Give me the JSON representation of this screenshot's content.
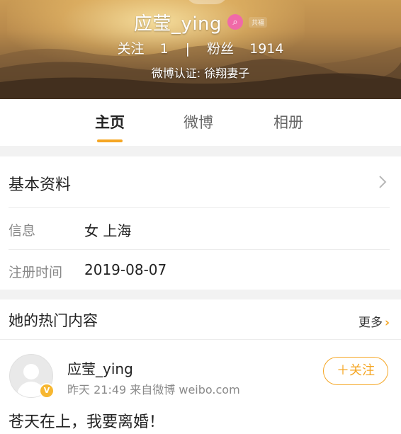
{
  "profile": {
    "name": "应莹_ying",
    "level_tag": "共福",
    "stats": {
      "following_label": "关注",
      "following_count": "1",
      "separator": "|",
      "followers_label": "粉丝",
      "followers_count": "1914"
    },
    "verification": "微博认证: 徐翔妻子"
  },
  "tabs": [
    {
      "label": "主页",
      "active": true
    },
    {
      "label": "微博",
      "active": false
    },
    {
      "label": "相册",
      "active": false
    }
  ],
  "basic_info": {
    "title": "基本资料",
    "rows": [
      {
        "label": "信息",
        "value": "女  上海"
      },
      {
        "label": "注册时间",
        "value": "2019-08-07"
      }
    ]
  },
  "hot_content": {
    "title": "她的热门内容",
    "more_label": "更多",
    "post": {
      "author": "应莹_ying",
      "meta": "昨天 21:49  来自微博 weibo.com",
      "follow_label": "＋关注",
      "text": "苍天在上，我要离婚！"
    }
  },
  "colors": {
    "accent": "#f5a623",
    "vip_pink": "#f06aa8",
    "section_gap": "#f2f2f2"
  },
  "icons": {
    "vip": "search-magnifier-badge",
    "chevron": "chevron-right",
    "verified": "verified-v-badge"
  }
}
